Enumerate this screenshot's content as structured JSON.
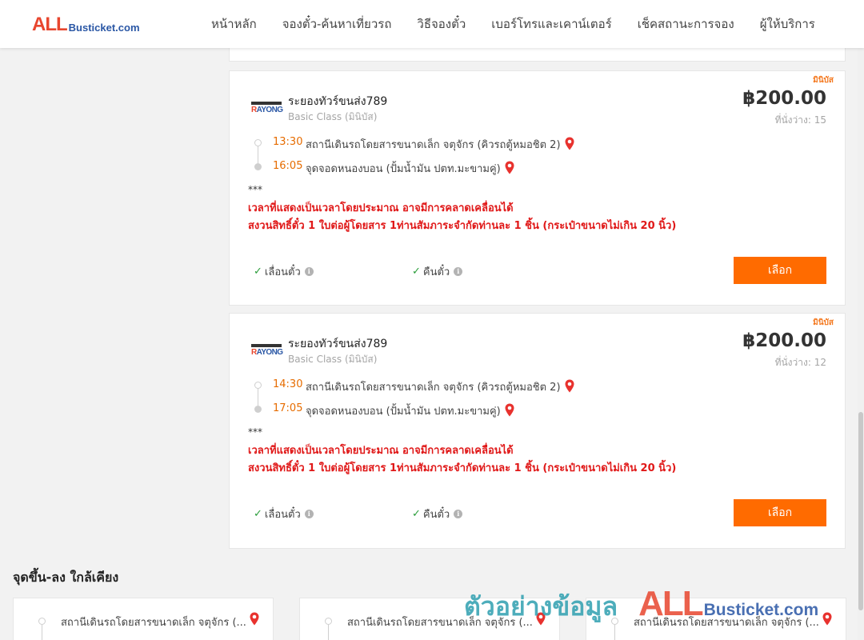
{
  "header": {
    "logo_all": "ALL",
    "logo_site": "Busticket.com",
    "nav": [
      "หน้าหลัก",
      "จองตั๋ว-ค้นหาเที่ยวรถ",
      "วิธีจองตั๋ว",
      "เบอร์โทรและเคาน์เตอร์",
      "เช็คสถานะการจอง",
      "ผู้ให้บริการ"
    ]
  },
  "trips": [
    {
      "tag": "มินิบัส",
      "logo_text_a": "R",
      "logo_text_b": "AYONG",
      "operator": "ระยองทัวร์ขนส่ง789",
      "bus_class": "Basic Class (มินิบัส)",
      "price": "฿200.00",
      "seats": "ที่นั่งว่าง: 15",
      "depart_time": "13:30",
      "depart_place": "สถานีเดินรถโดยสารขนาดเล็ก จตุจักร (คิวรถตู้หมอชิต 2)",
      "arrive_time": "16:05",
      "arrive_place": "จุดจอดหนองบอน (ปั้มน้ำมัน ปตท.มะขามคู่)",
      "stars": "***",
      "note1": "เวลาที่แสดงเป็นเวลาโดยประมาณ อาจมีการคลาดเคลื่อนได้",
      "note2": "สงวนสิทธิ์ตั๋ว 1 ใบต่อผู้โดยสาร 1ท่านสัมภาระจำกัดท่านละ 1 ชิ้น (กระเป๋าขนาดไม่เกิน 20 นิ้ว)",
      "feature1": "เลื่อนตั๋ว",
      "feature2": "คืนตั๋ว",
      "select_label": "เลือก"
    },
    {
      "tag": "มินิบัส",
      "logo_text_a": "R",
      "logo_text_b": "AYONG",
      "operator": "ระยองทัวร์ขนส่ง789",
      "bus_class": "Basic Class (มินิบัส)",
      "price": "฿200.00",
      "seats": "ที่นั่งว่าง: 12",
      "depart_time": "14:30",
      "depart_place": "สถานีเดินรถโดยสารขนาดเล็ก จตุจักร (คิวรถตู้หมอชิต 2)",
      "arrive_time": "17:05",
      "arrive_place": "จุดจอดหนองบอน (ปั้มน้ำมัน ปตท.มะขามคู่)",
      "stars": "***",
      "note1": "เวลาที่แสดงเป็นเวลาโดยประมาณ อาจมีการคลาดเคลื่อนได้",
      "note2": "สงวนสิทธิ์ตั๋ว 1 ใบต่อผู้โดยสาร 1ท่านสัมภาระจำกัดท่านละ 1 ชิ้น (กระเป๋าขนาดไม่เกิน 20 นิ้ว)",
      "feature1": "เลื่อนตั๋ว",
      "feature2": "คืนตั๋ว",
      "select_label": "เลือก"
    }
  ],
  "nearby": {
    "title": "จุดขึ้น-ลง ใกล้เคียง",
    "items": [
      "สถานีเดินรถโดยสารขนาดเล็ก จตุจักร (...",
      "สถานีเดินรถโดยสารขนาดเล็ก จตุจักร (...",
      "สถานีเดินรถโดยสารขนาดเล็ก จตุจักร (..."
    ]
  },
  "watermark": {
    "text": "ตัวอย่างข้อมูล",
    "all": "ALL",
    "site": "Busticket.com"
  },
  "colors": {
    "accent": "#ff6b00",
    "time": "#e66c00",
    "warning": "#e01818",
    "check": "#2a9d3a",
    "brand_red": "#e8462e",
    "brand_blue": "#2a57a5"
  },
  "icons": {
    "pin": "map-pin-icon",
    "check": "check-icon",
    "info": "info-icon"
  }
}
